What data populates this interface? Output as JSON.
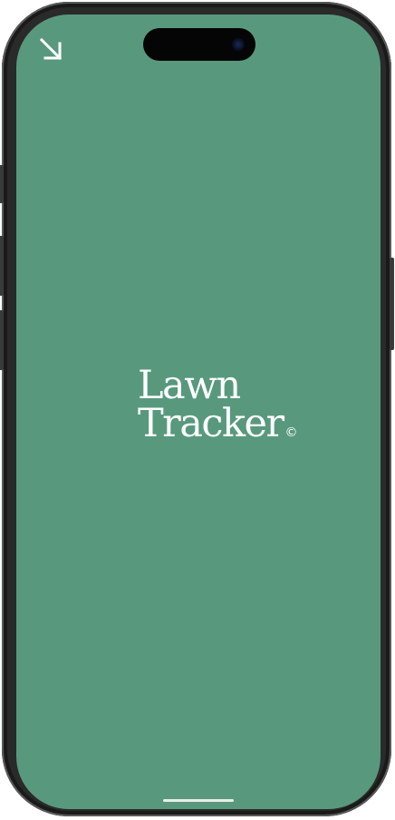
{
  "app": {
    "logo_line1": "Lawn",
    "logo_line2": "Tracker",
    "logo_mark": "©"
  },
  "icons": {
    "corner_arrow": "arrow-down-right-icon"
  },
  "colors": {
    "background": "#58997e",
    "text": "#ffffff"
  }
}
